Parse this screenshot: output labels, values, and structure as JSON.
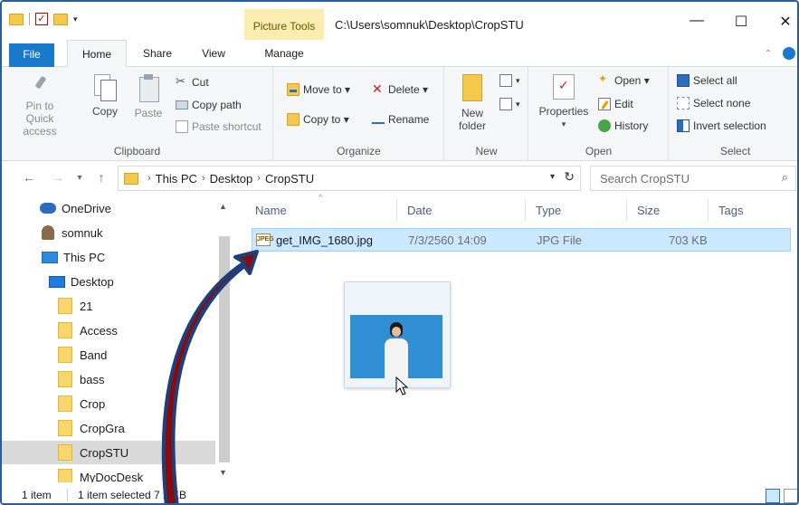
{
  "titlebar": {
    "picture_tools": "Picture Tools",
    "path": "C:\\Users\\somnuk\\Desktop\\CropSTU"
  },
  "tabs": {
    "file": "File",
    "home": "Home",
    "share": "Share",
    "view": "View",
    "manage": "Manage"
  },
  "ribbon": {
    "clipboard": {
      "label": "Clipboard",
      "pin": "Pin to Quick access",
      "copy": "Copy",
      "paste": "Paste",
      "cut": "Cut",
      "copy_path": "Copy path",
      "paste_shortcut": "Paste shortcut"
    },
    "organize": {
      "label": "Organize",
      "move_to": "Move to ▾",
      "copy_to": "Copy to ▾",
      "delete": "Delete ▾",
      "rename": "Rename"
    },
    "new": {
      "label": "New",
      "new_folder": "New folder"
    },
    "open": {
      "label": "Open",
      "properties": "Properties",
      "open": "Open ▾",
      "edit": "Edit",
      "history": "History"
    },
    "select": {
      "label": "Select",
      "select_all": "Select all",
      "select_none": "Select none",
      "invert_selection": "Invert selection"
    }
  },
  "addressbar": {
    "crumbs": [
      "This PC",
      "Desktop",
      "CropSTU"
    ],
    "search_placeholder": "Search CropSTU"
  },
  "navpane": {
    "items": [
      {
        "label": "OneDrive",
        "icon": "cloud-icon"
      },
      {
        "label": "somnuk",
        "icon": "user-icon"
      },
      {
        "label": "This PC",
        "icon": "pc-icon"
      },
      {
        "label": "Desktop",
        "icon": "desktop-icon"
      },
      {
        "label": "21",
        "icon": "folder-icon"
      },
      {
        "label": "Access",
        "icon": "folder-icon"
      },
      {
        "label": "Band",
        "icon": "folder-icon"
      },
      {
        "label": "bass",
        "icon": "folder-icon"
      },
      {
        "label": "Crop",
        "icon": "folder-icon"
      },
      {
        "label": "CropGra",
        "icon": "folder-icon"
      },
      {
        "label": "CropSTU",
        "icon": "folder-icon"
      },
      {
        "label": "MyDocDesk",
        "icon": "folder-icon"
      }
    ]
  },
  "columns": {
    "name": "Name",
    "date": "Date",
    "type": "Type",
    "size": "Size",
    "tags": "Tags"
  },
  "file": {
    "icon_text": "JPEG",
    "name": "get_IMG_1680.jpg",
    "date": "7/3/2560 14:09",
    "type": "JPG File",
    "size": "703 KB"
  },
  "status": {
    "count": "1 item",
    "selected": "1 item selected 7 2 KB"
  },
  "colors": {
    "accent": "#1979ca",
    "selection": "#cce8ff",
    "arrow": "#8b0a0a",
    "arrow_outline": "#1f3f7a"
  }
}
